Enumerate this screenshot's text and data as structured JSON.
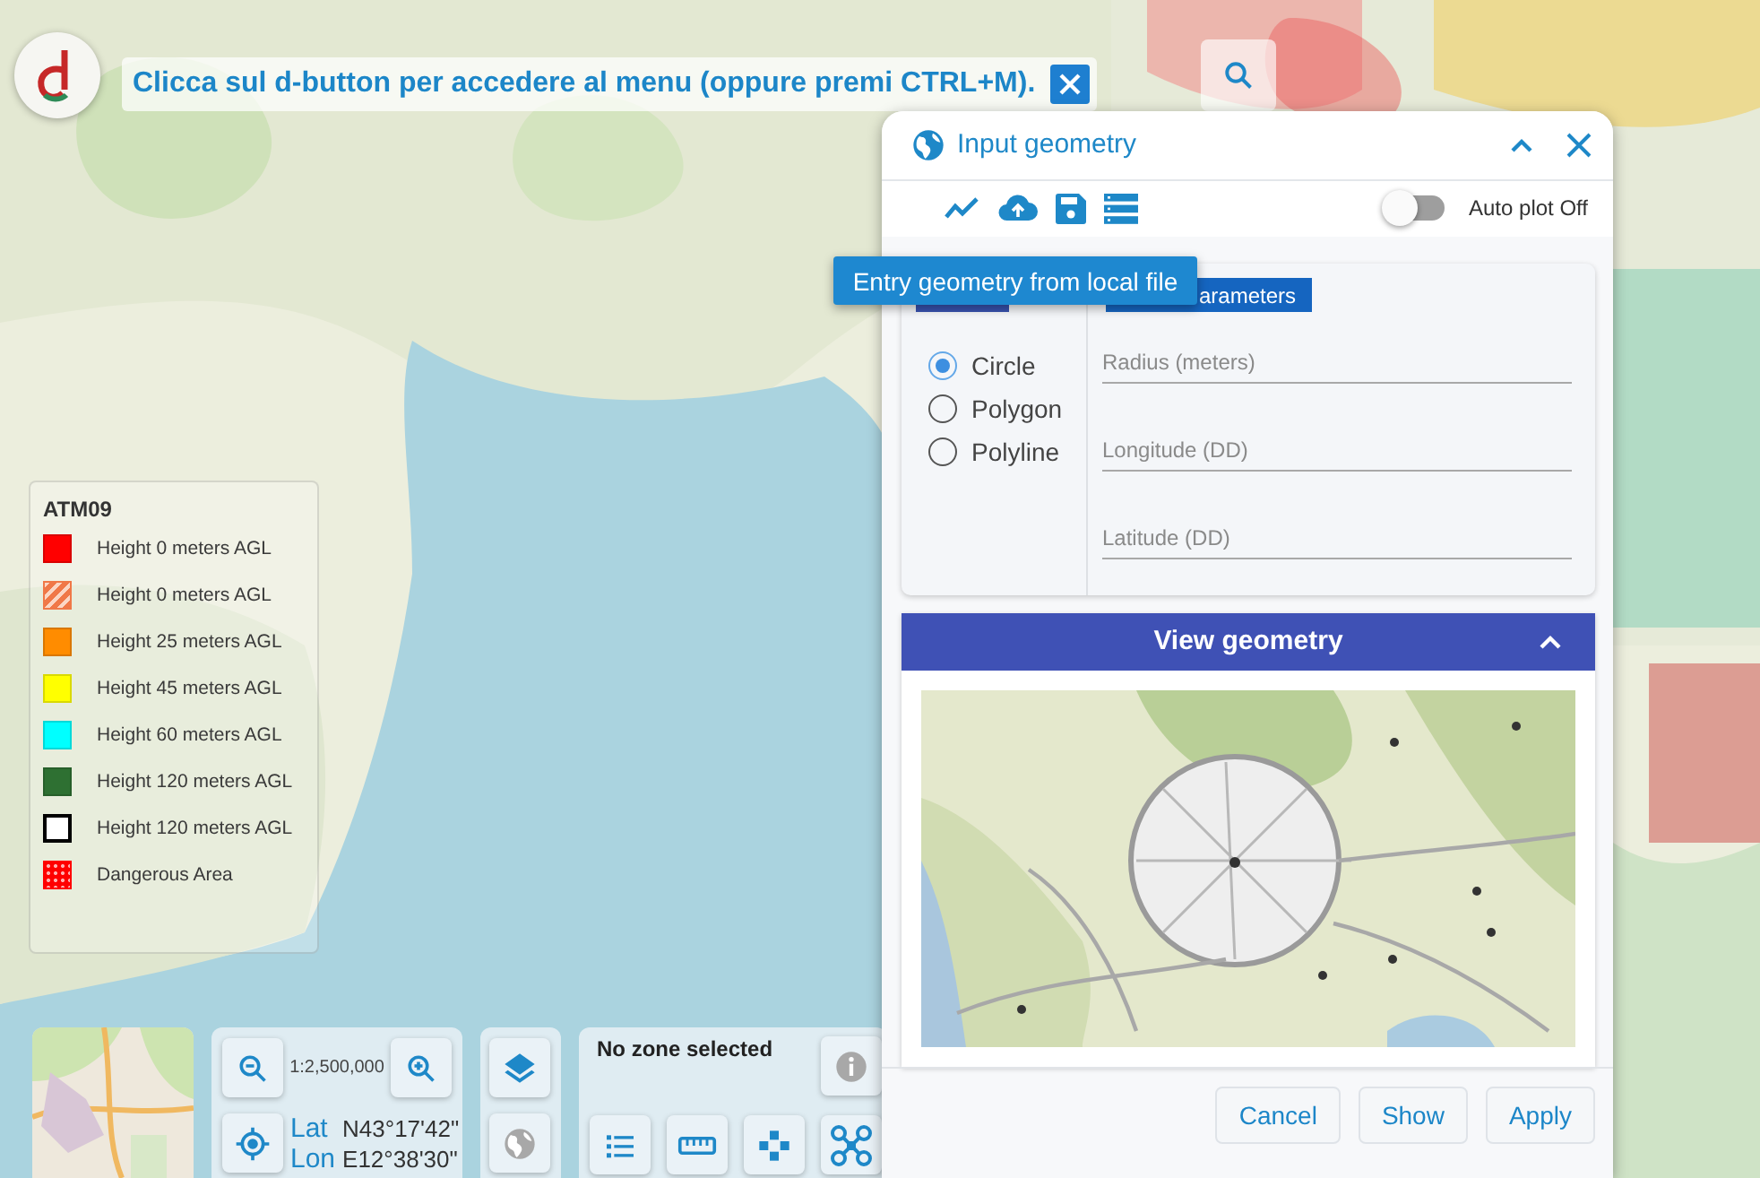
{
  "hint": {
    "text": "Clicca sul d-button per accedere al menu (oppure premi CTRL+M)."
  },
  "input_geometry": {
    "title": "Input geometry",
    "auto_plot": {
      "label": "Auto plot Off",
      "on": false
    },
    "tooltip": "Entry geometry from local file",
    "tabs": [
      {
        "selected": false
      },
      {
        "label": "arameters",
        "selected": true
      }
    ],
    "geometry_types": [
      {
        "label": "Circle",
        "selected": true
      },
      {
        "label": "Polygon",
        "selected": false
      },
      {
        "label": "Polyline",
        "selected": false
      }
    ],
    "fields": [
      {
        "placeholder": "Radius (meters)"
      },
      {
        "placeholder": "Longitude (DD)"
      },
      {
        "placeholder": "Latitude (DD)"
      }
    ],
    "view_geometry": {
      "title": "View geometry",
      "expanded": true
    },
    "buttons": [
      "Cancel",
      "Show",
      "Apply"
    ]
  },
  "legend": {
    "title": "ATM09",
    "items": [
      {
        "label": "Height 0 meters AGL",
        "color": "#ff0000",
        "kind": "solid"
      },
      {
        "label": "Height 0 meters AGL",
        "color": "#f07848",
        "kind": "hatched"
      },
      {
        "label": "Height 25 meters AGL",
        "color": "#ff8c00",
        "kind": "solid"
      },
      {
        "label": "Height 45 meters AGL",
        "color": "#ffff00",
        "kind": "solid"
      },
      {
        "label": "Height 60 meters AGL",
        "color": "#00ffff",
        "kind": "solid"
      },
      {
        "label": "Height 120 meters AGL",
        "color": "#2e7032",
        "kind": "solid"
      },
      {
        "label": "Height 120 meters AGL",
        "color": "#000000",
        "kind": "outline"
      },
      {
        "label": "Dangerous Area",
        "color": "#ff0000",
        "kind": "dotted"
      }
    ]
  },
  "map_controls": {
    "scale": "1:2,500,000",
    "lat_label": "Lat",
    "lat": "N43°17'42\"",
    "lon_label": "Lon",
    "lon": "E12°38'30\"",
    "globe_disabled": true
  },
  "zone": {
    "status": "No zone selected",
    "info_disabled": true
  }
}
